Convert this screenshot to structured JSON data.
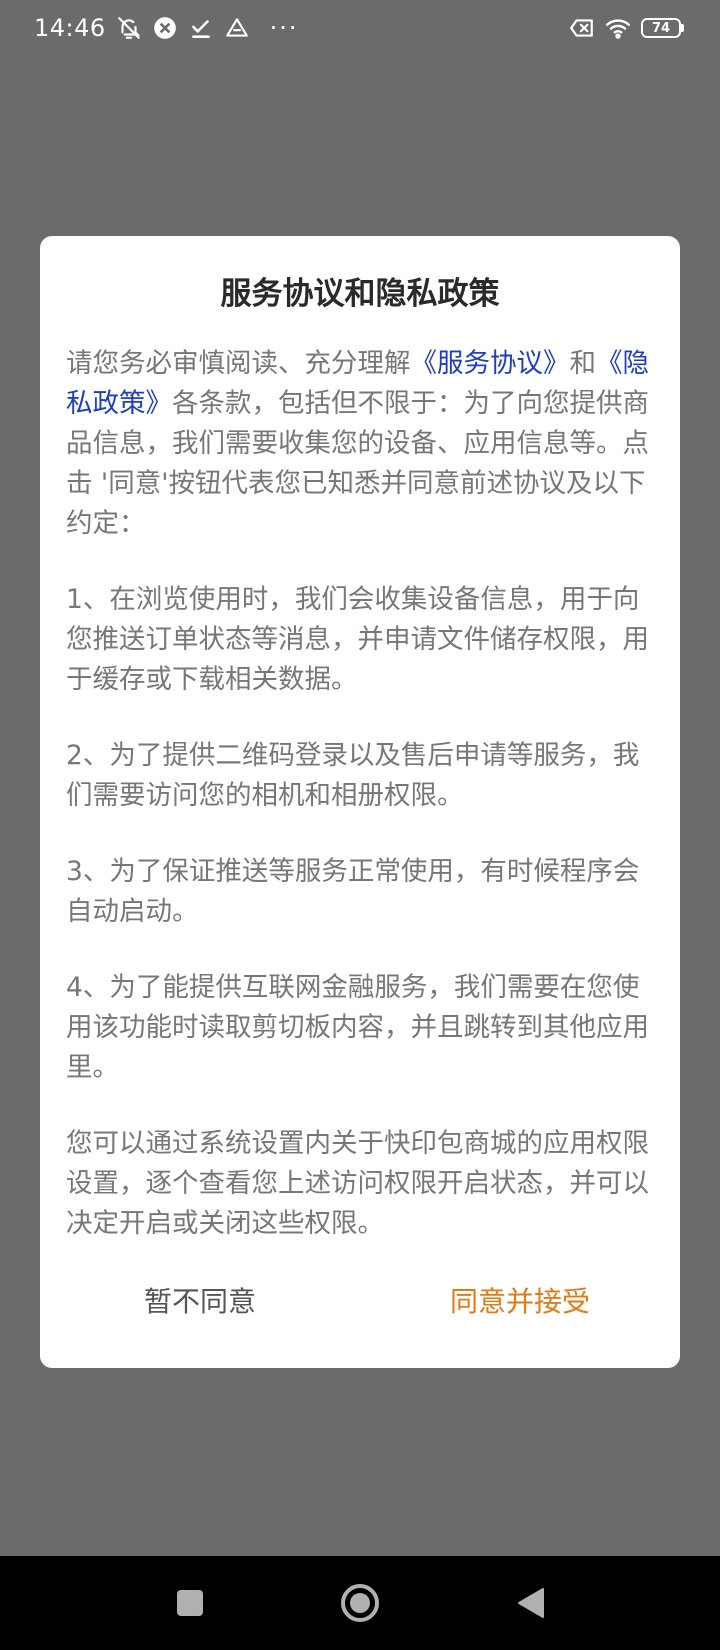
{
  "status_bar": {
    "time": "14:46",
    "battery_level": "74",
    "more_indicator": "···",
    "icons": [
      "alarm-off-icon",
      "sync-icon",
      "check-icon",
      "drive-icon",
      "sim-x-icon",
      "wifi-icon",
      "battery-icon"
    ]
  },
  "dialog": {
    "title": "服务协议和隐私政策",
    "intro": {
      "part1": "请您务必审慎阅读、充分理解",
      "link1": "《服务协议》",
      "part2": "和",
      "link2": "《隐私政策》",
      "part3": "各条款，包括但不限于：为了向您提供商品信息，我们需要收集您的设备、应用信息等。点击 '同意'按钮代表您已知悉并同意前述协议及以下约定："
    },
    "items": [
      "1、在浏览使用时，我们会收集设备信息，用于向您推送订单状态等消息，并申请文件储存权限，用于缓存或下载相关数据。",
      "2、为了提供二维码登录以及售后申请等服务，我们需要访问您的相机和相册权限。",
      "3、为了保证推送等服务正常使用，有时候程序会自动启动。",
      "4、为了能提供互联网金融服务，我们需要在您使用该功能时读取剪切板内容，并且跳转到其他应用里。"
    ],
    "closing": "您可以通过系统设置内关于快印包商城的应用权限设置，逐个查看您上述访问权限开启状态，并可以决定开启或关闭这些权限。",
    "decline_label": "暂不同意",
    "accept_label": "同意并接受"
  },
  "colors": {
    "overlay": "#6b6b6b",
    "link": "#1f3fbf",
    "accept": "#e07b16",
    "body_text": "#777777"
  }
}
